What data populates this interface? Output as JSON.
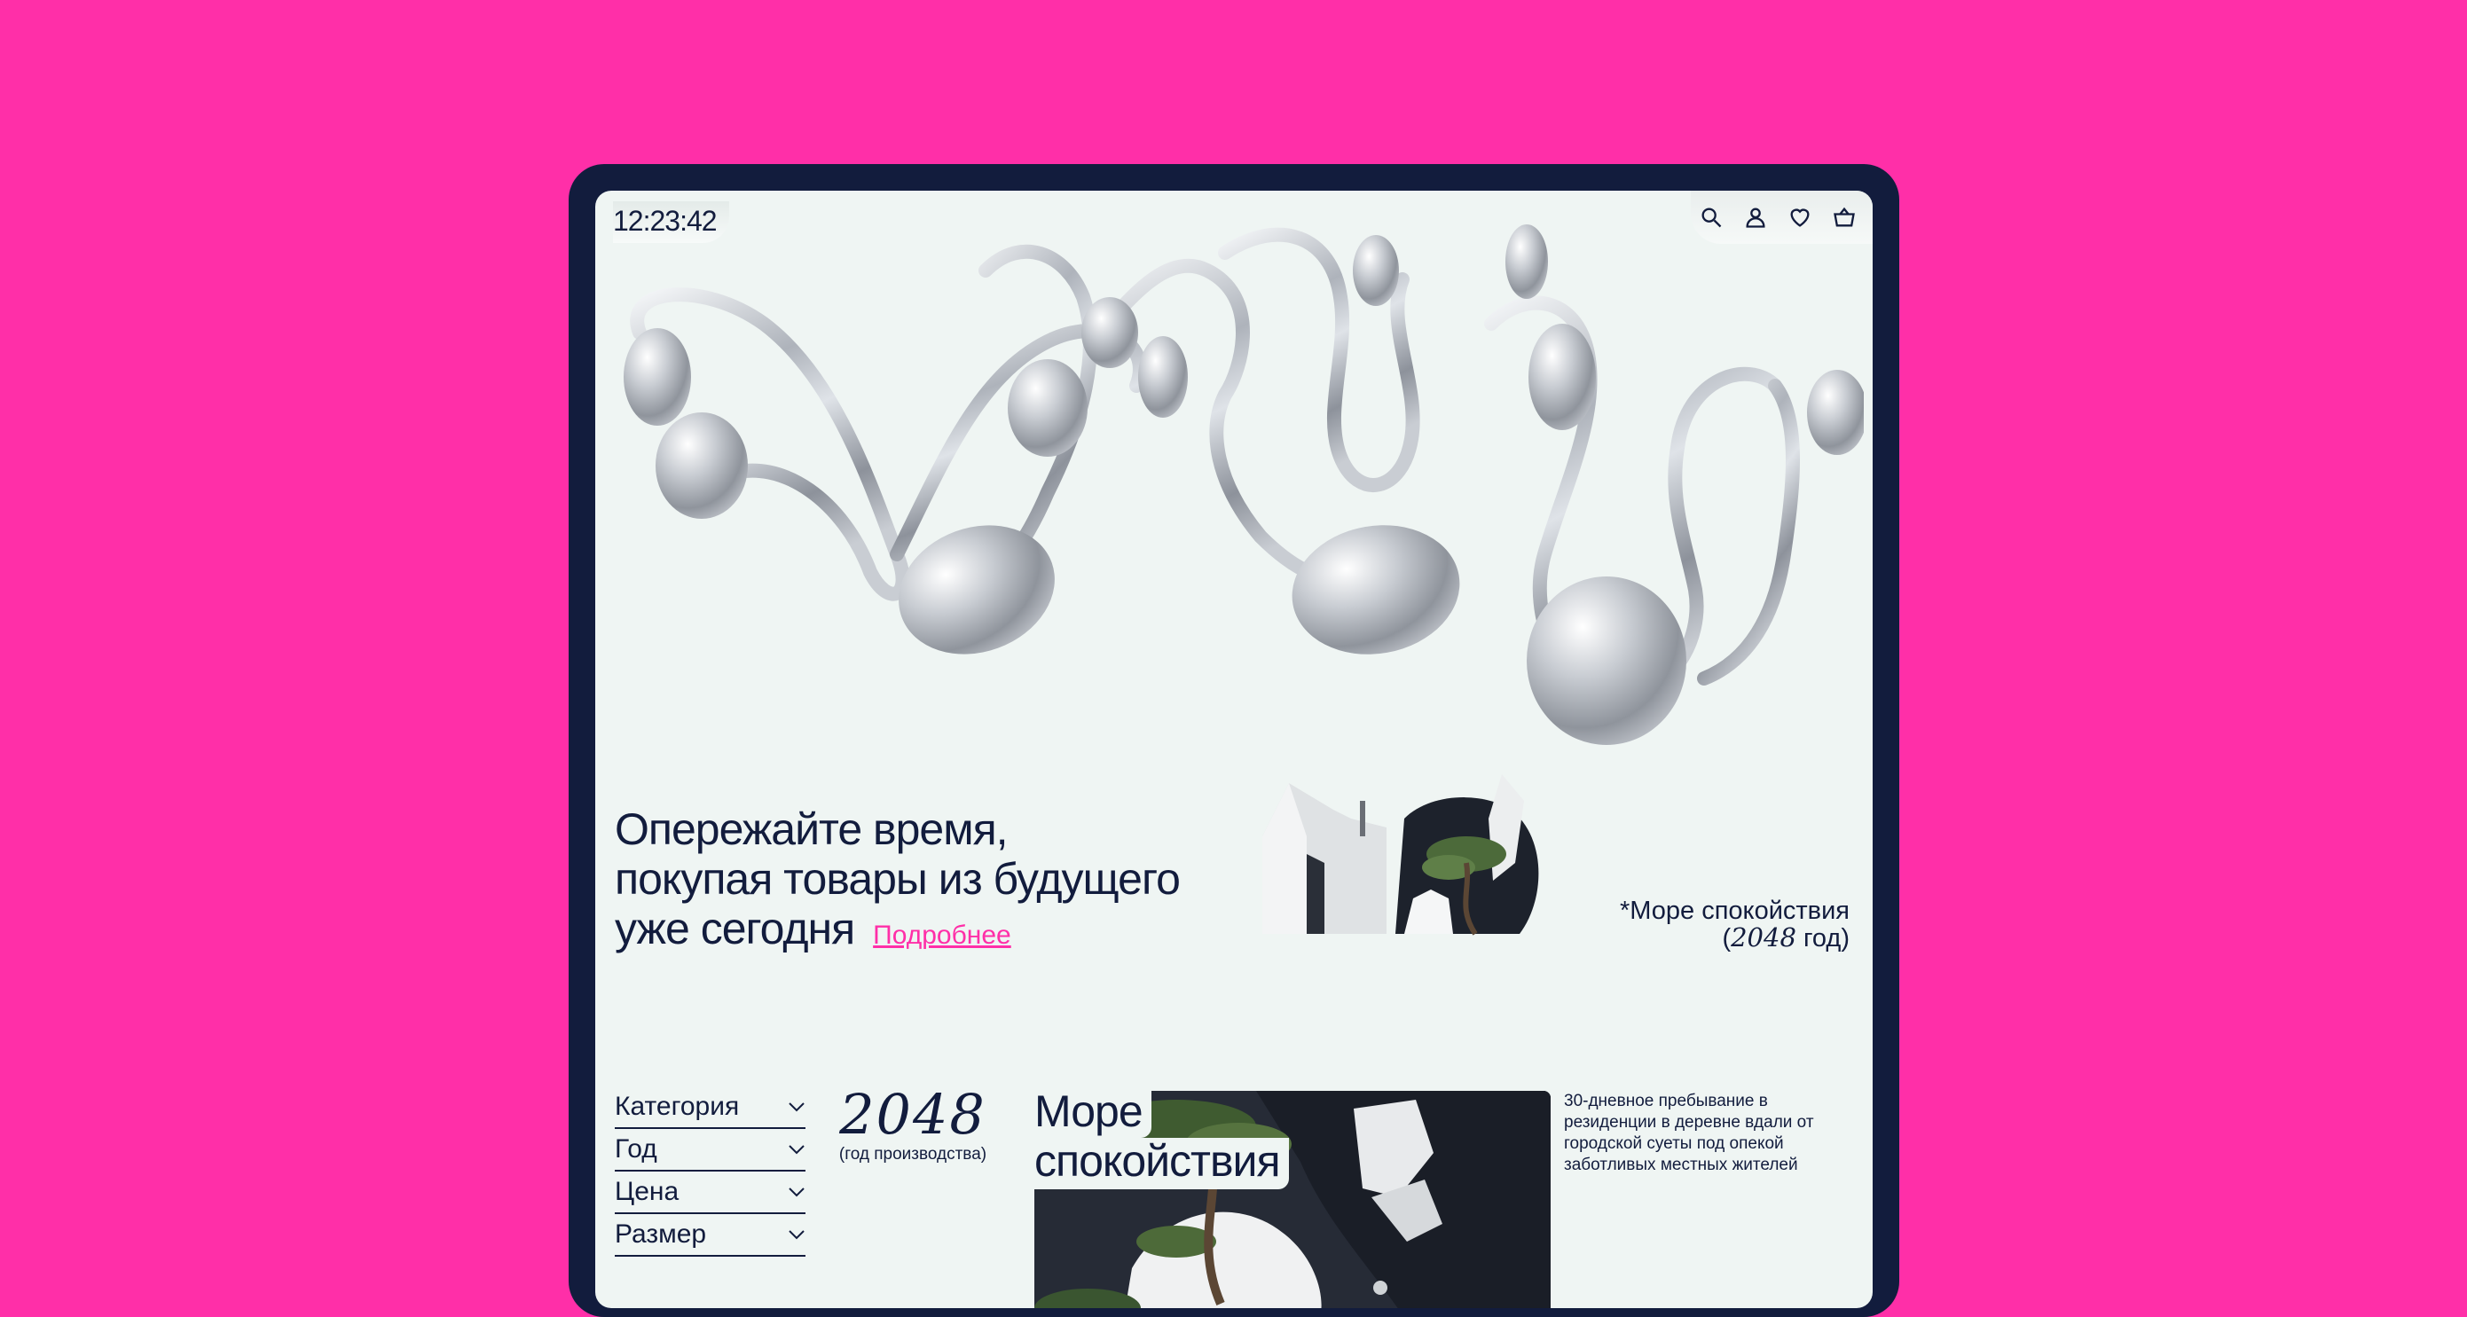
{
  "header": {
    "clock": "12:23:42",
    "icons": [
      "search-icon",
      "user-icon",
      "heart-icon",
      "cart-icon"
    ]
  },
  "hero": {
    "line1": "Опережайте время,",
    "line2": "покупая товары из будущего",
    "line3": "уже сегодня",
    "link_label": "Подробнее",
    "caption_line1": "*Море спокойствия",
    "caption_open": "(",
    "caption_year": "2048",
    "caption_close": " год)"
  },
  "filters": [
    {
      "label": "Категория"
    },
    {
      "label": "Год"
    },
    {
      "label": "Цена"
    },
    {
      "label": "Размер"
    }
  ],
  "product": {
    "year": "2048",
    "year_caption": "(год производства)",
    "title_line1": "Море",
    "title_line2": "спокойствия",
    "description": "30-дневное пребывание в резиденции в деревне вдали от городской суеты под опекой заботливых местных жителей"
  },
  "colors": {
    "background": "#ff2fa8",
    "device": "#121c3d",
    "screen": "#eff5f3",
    "text": "#121c3d",
    "accent": "#ff2fa8"
  }
}
